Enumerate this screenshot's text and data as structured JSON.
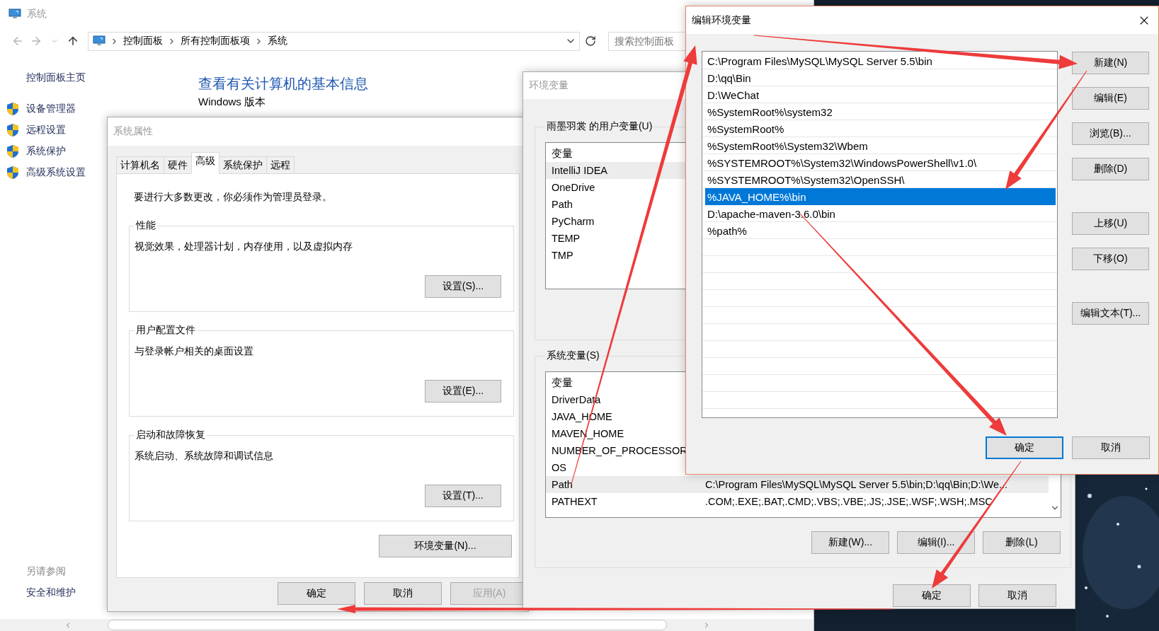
{
  "system_window": {
    "title": "系统",
    "breadcrumb": [
      "控制面板",
      "所有控制面板项",
      "系统"
    ],
    "search": {
      "placeholder": "搜索控制面板"
    },
    "sidebar": {
      "home": "控制面板主页",
      "items": [
        "设备管理器",
        "远程设置",
        "系统保护",
        "高级系统设置"
      ],
      "see_also": "另请参阅",
      "links": [
        "安全和维护"
      ]
    },
    "heading": "查看有关计算机的基本信息",
    "section_title": "Windows 版本"
  },
  "system_properties": {
    "title": "系统属性",
    "tabs": [
      {
        "label": "计算机名",
        "selected": false
      },
      {
        "label": "硬件",
        "selected": false
      },
      {
        "label": "高级",
        "selected": true
      },
      {
        "label": "系统保护",
        "selected": false
      },
      {
        "label": "远程",
        "selected": false
      }
    ],
    "notice": "要进行大多数更改，你必须作为管理员登录。",
    "groups": [
      {
        "title": "性能",
        "description": "视觉效果，处理器计划，内存使用，以及虚拟内存",
        "button": "设置(S)..."
      },
      {
        "title": "用户配置文件",
        "description": "与登录帐户相关的桌面设置",
        "button": "设置(E)..."
      },
      {
        "title": "启动和故障恢复",
        "description": "系统启动、系统故障和调试信息",
        "button": "设置(T)..."
      }
    ],
    "env_button": "环境变量(N)...",
    "buttons": [
      {
        "label": "确定",
        "disabled": false
      },
      {
        "label": "取消",
        "disabled": false
      },
      {
        "label": "应用(A)",
        "disabled": true
      }
    ]
  },
  "environment_variables": {
    "title": "环境变量",
    "user_vars": {
      "title": "雨墨羽裳 的用户变量(U)",
      "header": "变量",
      "rows": [
        {
          "name": "IntelliJ IDEA",
          "selected": true
        },
        {
          "name": "OneDrive",
          "selected": false
        },
        {
          "name": "Path",
          "selected": false
        },
        {
          "name": "PyCharm",
          "selected": false
        },
        {
          "name": "TEMP",
          "selected": false
        },
        {
          "name": "TMP",
          "selected": false
        }
      ]
    },
    "system_vars": {
      "title": "系统变量(S)",
      "header": "变量",
      "rows": [
        {
          "name": "DriverData",
          "selected": false
        },
        {
          "name": "JAVA_HOME",
          "selected": false
        },
        {
          "name": "MAVEN_HOME",
          "selected": false
        },
        {
          "name": "NUMBER_OF_PROCESSOR",
          "selected": false
        },
        {
          "name": "OS",
          "selected": false
        },
        {
          "name": "Path",
          "value": "C:\\Program Files\\MySQL\\MySQL Server 5.5\\bin;D:\\qq\\Bin;D:\\We...",
          "selected": true
        },
        {
          "name": "PATHEXT",
          "value": ".COM;.EXE;.BAT;.CMD;.VBS;.VBE;.JS;.JSE;.WSF;.WSH;.MSC",
          "selected": false
        }
      ]
    },
    "row_buttons": [
      "新建(W)...",
      "编辑(I)...",
      "删除(L)"
    ],
    "buttons": [
      "确定",
      "取消"
    ]
  },
  "edit_variable": {
    "title": "编辑环境变量",
    "entries": [
      {
        "text": "C:\\Program Files\\MySQL\\MySQL Server 5.5\\bin",
        "selected": false
      },
      {
        "text": "D:\\qq\\Bin",
        "selected": false
      },
      {
        "text": "D:\\WeChat",
        "selected": false
      },
      {
        "text": "%SystemRoot%\\system32",
        "selected": false
      },
      {
        "text": "%SystemRoot%",
        "selected": false
      },
      {
        "text": "%SystemRoot%\\System32\\Wbem",
        "selected": false
      },
      {
        "text": "%SYSTEMROOT%\\System32\\WindowsPowerShell\\v1.0\\",
        "selected": false
      },
      {
        "text": "%SYSTEMROOT%\\System32\\OpenSSH\\",
        "selected": false
      },
      {
        "text": "%JAVA_HOME%\\bin",
        "selected": true
      },
      {
        "text": "D:\\apache-maven-3.6.0\\bin",
        "selected": false
      },
      {
        "text": "%path%",
        "selected": false
      }
    ],
    "side_buttons": [
      [
        "新建(N)",
        "编辑(E)",
        "浏览(B)...",
        "删除(D)"
      ],
      [
        "上移(U)",
        "下移(O)"
      ],
      [
        "编辑文本(T)..."
      ]
    ],
    "buttons": [
      {
        "label": "确定",
        "default": true
      },
      {
        "label": "取消",
        "default": false
      }
    ]
  }
}
